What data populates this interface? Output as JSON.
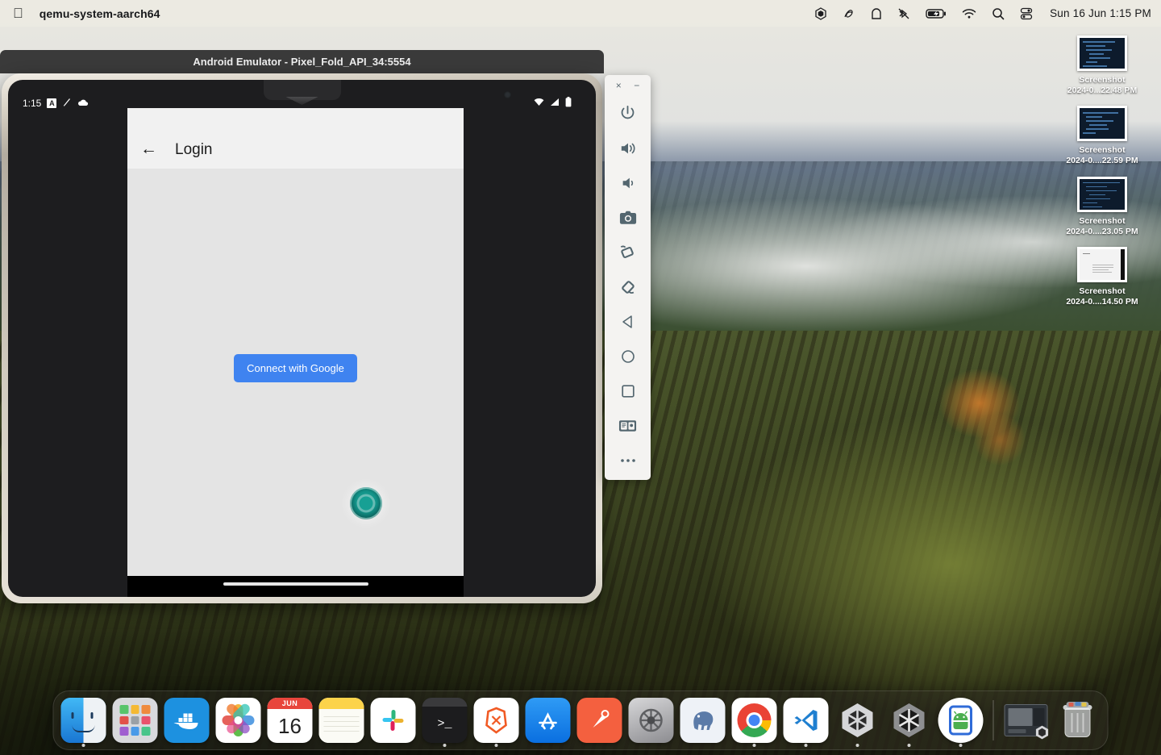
{
  "menubar": {
    "apple_logo": "apple-logo",
    "app_title": "qemu-system-aarch64",
    "clock": "Sun 16 Jun 1:15 PM",
    "status_icons": [
      {
        "name": "unity-icon",
        "glyph": "unity"
      },
      {
        "name": "scribble-icon",
        "glyph": "scribble"
      },
      {
        "name": "vpn-lock-icon",
        "glyph": "vpn"
      },
      {
        "name": "bluetooth-off-icon",
        "glyph": "bluetooth-off"
      },
      {
        "name": "battery-charging-icon",
        "glyph": "battery"
      },
      {
        "name": "wifi-icon",
        "glyph": "wifi"
      },
      {
        "name": "spotlight-search-icon",
        "glyph": "search"
      },
      {
        "name": "control-center-icon",
        "glyph": "control-center"
      }
    ]
  },
  "desktop_icons": [
    {
      "name": "screenshot-file-1",
      "label_line1": "Screenshot",
      "label_line2": "2024-0...22.48 PM",
      "kind": "code"
    },
    {
      "name": "screenshot-file-2",
      "label_line1": "Screenshot",
      "label_line2": "2024-0....22.59 PM",
      "kind": "code"
    },
    {
      "name": "screenshot-file-3",
      "label_line1": "Screenshot",
      "label_line2": "2024-0....23.05 PM",
      "kind": "code"
    },
    {
      "name": "screenshot-file-4",
      "label_line1": "Screenshot",
      "label_line2": "2024-0....14.50 PM",
      "kind": "doc"
    }
  ],
  "emulator": {
    "window_title": "Android Emulator - Pixel_Fold_API_34:5554",
    "toolbar": {
      "close_label": "×",
      "minimize_label": "−",
      "buttons": [
        {
          "name": "power-button",
          "label": "Power"
        },
        {
          "name": "volume-up-button",
          "label": "Volume Up"
        },
        {
          "name": "volume-down-button",
          "label": "Volume Down"
        },
        {
          "name": "screenshot-button",
          "label": "Take Screenshot"
        },
        {
          "name": "rotate-left-button",
          "label": "Rotate Left"
        },
        {
          "name": "rotate-right-button",
          "label": "Rotate Right"
        },
        {
          "name": "back-button",
          "label": "Back"
        },
        {
          "name": "home-button",
          "label": "Home"
        },
        {
          "name": "overview-button",
          "label": "Overview"
        },
        {
          "name": "fold-device-button",
          "label": "Fold/Unfold"
        },
        {
          "name": "more-button",
          "label": "More"
        }
      ]
    },
    "android_status_bar": {
      "time": "1:15",
      "left_icons": [
        "a-badge-icon",
        "pen-slash-icon",
        "cloud-icon"
      ],
      "right_icons": [
        "wifi-icon",
        "cellular-signal-icon",
        "battery-icon"
      ]
    },
    "app": {
      "back_arrow": "←",
      "title": "Login",
      "connect_button_label": "Connect with Google",
      "connect_button_color": "#3f83f0",
      "surface_color": "#e4e4e4",
      "appbar_color": "#f1f1f1"
    }
  },
  "dock": {
    "items": [
      {
        "name": "dock-item-finder",
        "label": "Finder",
        "running": true
      },
      {
        "name": "dock-item-launchpad",
        "label": "Launchpad",
        "running": false
      },
      {
        "name": "dock-item-docker",
        "label": "Docker",
        "running": false
      },
      {
        "name": "dock-item-photos",
        "label": "Photos",
        "running": false
      },
      {
        "name": "dock-item-calendar",
        "label": "Calendar",
        "running": false,
        "month": "JUN",
        "day": "16"
      },
      {
        "name": "dock-item-notes",
        "label": "Notes",
        "running": false
      },
      {
        "name": "dock-item-slack",
        "label": "Slack",
        "running": false
      },
      {
        "name": "dock-item-terminal",
        "label": "Terminal",
        "running": true
      },
      {
        "name": "dock-item-brave",
        "label": "Brave Browser",
        "running": true
      },
      {
        "name": "dock-item-app-store",
        "label": "App Store",
        "running": false
      },
      {
        "name": "dock-item-postman",
        "label": "Postman",
        "running": false
      },
      {
        "name": "dock-item-system-settings",
        "label": "System Settings",
        "running": false
      },
      {
        "name": "dock-item-postgres",
        "label": "pgAdmin",
        "running": false
      },
      {
        "name": "dock-item-chrome",
        "label": "Google Chrome",
        "running": true
      },
      {
        "name": "dock-item-vscode",
        "label": "Visual Studio Code",
        "running": true
      },
      {
        "name": "dock-item-unity-hub",
        "label": "Unity Hub",
        "running": true
      },
      {
        "name": "dock-item-unity-editor",
        "label": "Unity Editor",
        "running": true
      },
      {
        "name": "dock-item-android-emulator",
        "label": "Android Emulator",
        "running": true
      }
    ],
    "minimized": [
      {
        "name": "dock-minimized-unity-window",
        "label": "Unity Window"
      }
    ],
    "trash": {
      "name": "dock-item-trash",
      "label": "Trash"
    }
  }
}
